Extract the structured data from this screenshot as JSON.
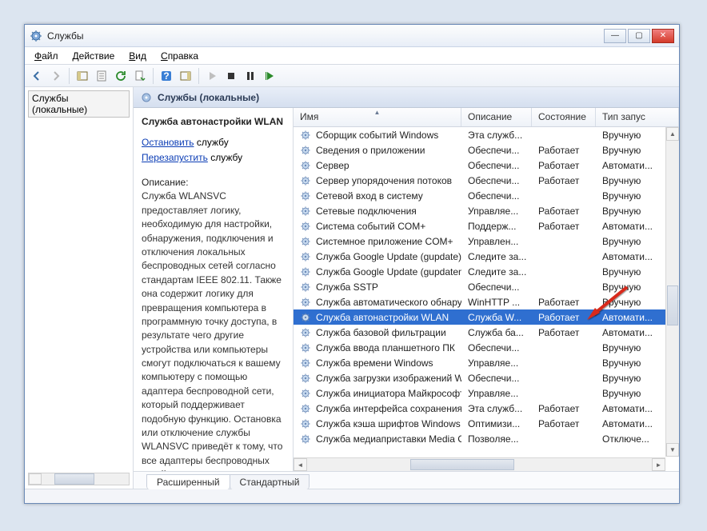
{
  "window": {
    "title": "Службы"
  },
  "menu": {
    "file": "Файл",
    "action": "Действие",
    "view": "Вид",
    "help": "Справка"
  },
  "tree": {
    "root": "Службы (локальные)"
  },
  "header": {
    "title": "Службы (локальные)"
  },
  "detail": {
    "title": "Служба автонастройки WLAN",
    "stop_link": "Остановить",
    "stop_suffix": " службу",
    "restart_link": "Перезапустить",
    "restart_suffix": " службу",
    "desc_label": "Описание:",
    "description": "Служба WLANSVC предоставляет логику, необходимую для настройки, обнаружения, подключения и отключения локальных беспроводных сетей согласно стандартам IEEE 802.11. Также она содержит логику для превращения компьютера в программную точку доступа, в результате чего другие устройства или компьютеры смогут подключаться к вашему компьютеру с помощью адаптера беспроводной сети, который поддерживает подобную функцию. Остановка или отключение службы WLANSVC приведёт к тому, что все адаптеры беспроводных сетей на этом компьютере станут недоступны из раздела"
  },
  "columns": {
    "name": "Имя",
    "desc": "Описание",
    "state": "Состояние",
    "start": "Тип запус"
  },
  "services": [
    {
      "name": "Сборщик событий Windows",
      "desc": "Эта служб...",
      "state": "",
      "start": "Вручную"
    },
    {
      "name": "Сведения о приложении",
      "desc": "Обеспечи...",
      "state": "Работает",
      "start": "Вручную"
    },
    {
      "name": "Сервер",
      "desc": "Обеспечи...",
      "state": "Работает",
      "start": "Автомати..."
    },
    {
      "name": "Сервер упорядочения потоков",
      "desc": "Обеспечи...",
      "state": "Работает",
      "start": "Вручную"
    },
    {
      "name": "Сетевой вход в систему",
      "desc": "Обеспечи...",
      "state": "",
      "start": "Вручную"
    },
    {
      "name": "Сетевые подключения",
      "desc": "Управляе...",
      "state": "Работает",
      "start": "Вручную"
    },
    {
      "name": "Система событий COM+",
      "desc": "Поддерж...",
      "state": "Работает",
      "start": "Автомати..."
    },
    {
      "name": "Системное приложение COM+",
      "desc": "Управлен...",
      "state": "",
      "start": "Вручную"
    },
    {
      "name": "Служба Google Update (gupdate)",
      "desc": "Следите за...",
      "state": "",
      "start": "Автомати..."
    },
    {
      "name": "Служба Google Update (gupdatem)",
      "desc": "Следите за...",
      "state": "",
      "start": "Вручную"
    },
    {
      "name": "Служба SSTP",
      "desc": "Обеспечи...",
      "state": "",
      "start": "Вручную"
    },
    {
      "name": "Служба автоматического обнару...",
      "desc": "WinHTTP ...",
      "state": "Работает",
      "start": "Вручную"
    },
    {
      "name": "Служба автонастройки WLAN",
      "desc": "Служба W...",
      "state": "Работает",
      "start": "Автомати...",
      "selected": true
    },
    {
      "name": "Служба базовой фильтрации",
      "desc": "Служба ба...",
      "state": "Работает",
      "start": "Автомати..."
    },
    {
      "name": "Служба ввода планшетного ПК",
      "desc": "Обеспечи...",
      "state": "",
      "start": "Вручную"
    },
    {
      "name": "Служба времени Windows",
      "desc": "Управляе...",
      "state": "",
      "start": "Вручную"
    },
    {
      "name": "Служба загрузки изображений Wi...",
      "desc": "Обеспечи...",
      "state": "",
      "start": "Вручную"
    },
    {
      "name": "Служба инициатора Майкрософт...",
      "desc": "Управляе...",
      "state": "",
      "start": "Вручную"
    },
    {
      "name": "Служба интерфейса сохранения с...",
      "desc": "Эта служб...",
      "state": "Работает",
      "start": "Автомати..."
    },
    {
      "name": "Служба кэша шрифтов Windows",
      "desc": "Оптимизи...",
      "state": "Работает",
      "start": "Автомати..."
    },
    {
      "name": "Служба медиаприставки Media C...",
      "desc": "Позволяе...",
      "state": "",
      "start": "Отключе..."
    }
  ],
  "tabs": {
    "extended": "Расширенный",
    "standard": "Стандартный"
  }
}
